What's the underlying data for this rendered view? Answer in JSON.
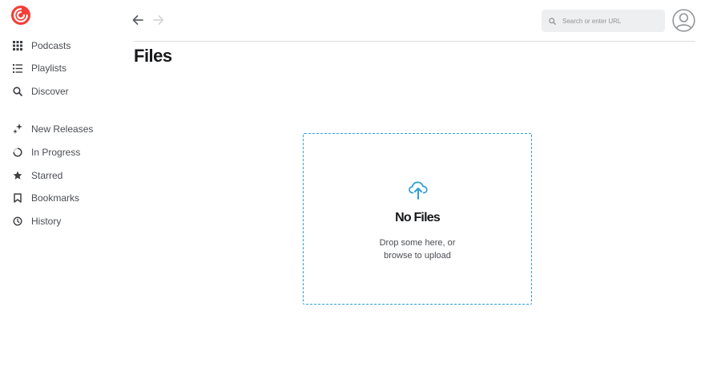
{
  "app": {
    "brand_color": "#f43e37",
    "accent_color": "#2d9fd6"
  },
  "sidebar": {
    "items": [
      {
        "label": "Podcasts",
        "icon": "grid-icon"
      },
      {
        "label": "Playlists",
        "icon": "list-icon"
      },
      {
        "label": "Discover",
        "icon": "search-icon"
      },
      {
        "label": "New Releases",
        "icon": "sparkle-icon"
      },
      {
        "label": "In Progress",
        "icon": "progress-circle-icon"
      },
      {
        "label": "Starred",
        "icon": "star-icon"
      },
      {
        "label": "Bookmarks",
        "icon": "bookmark-icon"
      },
      {
        "label": "History",
        "icon": "clock-icon"
      }
    ]
  },
  "header": {
    "search_placeholder": "Search or enter URL"
  },
  "main": {
    "title": "Files",
    "empty_state": {
      "title": "No Files",
      "line1": "Drop some here, or",
      "line2": "browse to upload"
    }
  }
}
